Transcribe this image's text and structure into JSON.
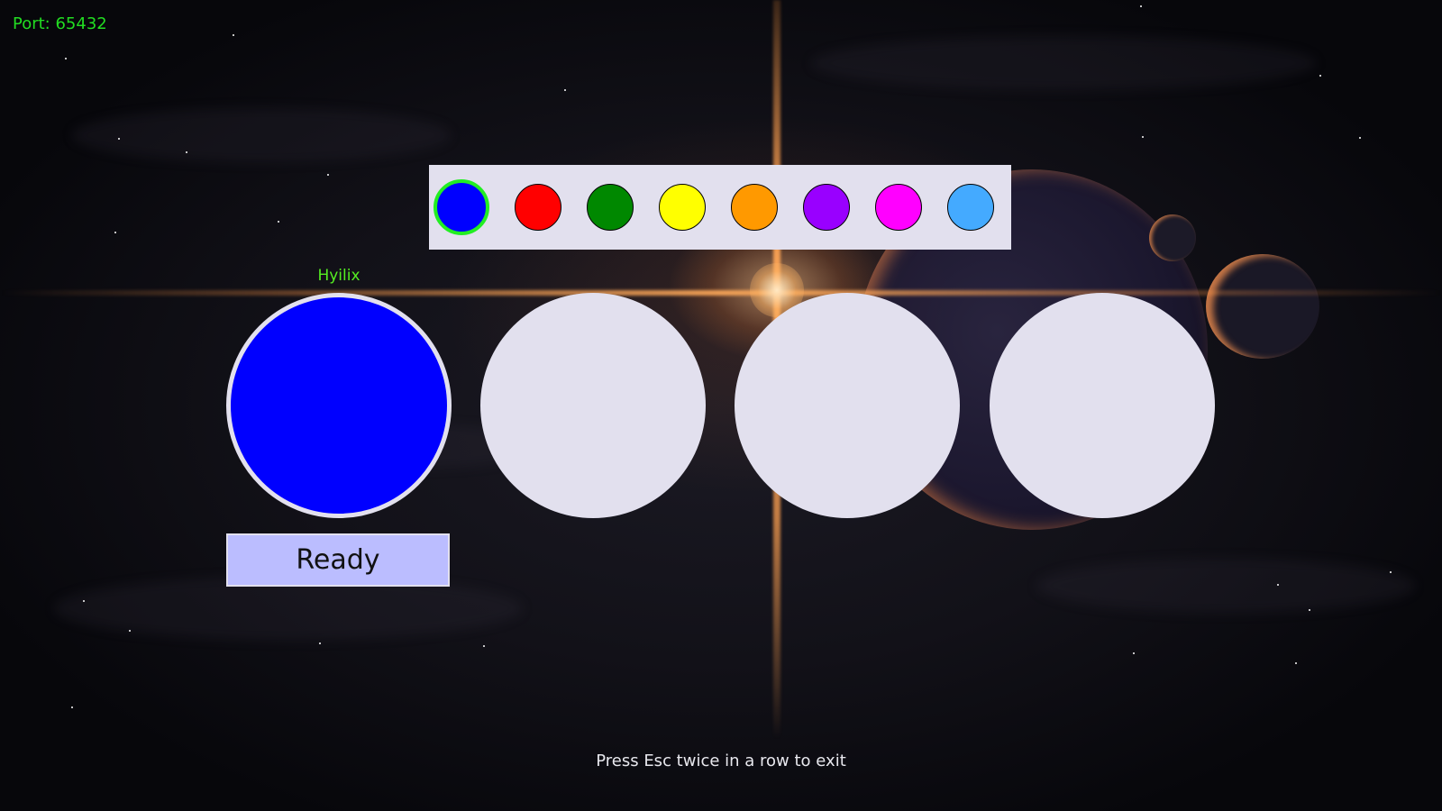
{
  "connection": {
    "port_text": "Port: 65432"
  },
  "palette": {
    "selected_index": 0,
    "colors": [
      {
        "name": "blue",
        "hex": "#0000ff"
      },
      {
        "name": "red",
        "hex": "#ff0000"
      },
      {
        "name": "green",
        "hex": "#008800"
      },
      {
        "name": "yellow",
        "hex": "#ffff00"
      },
      {
        "name": "orange",
        "hex": "#ff9900"
      },
      {
        "name": "purple",
        "hex": "#9900ff"
      },
      {
        "name": "magenta",
        "hex": "#ff00ff"
      },
      {
        "name": "sky-blue",
        "hex": "#44aaff"
      }
    ],
    "selection_ring_color": "#22ee22",
    "background_color": "#e2e0ee"
  },
  "players": [
    {
      "name": "Hyilix",
      "color": "#0000ff",
      "occupied": true
    },
    {
      "name": "",
      "color": "#e2e0ee",
      "occupied": false
    },
    {
      "name": "",
      "color": "#e2e0ee",
      "occupied": false
    },
    {
      "name": "",
      "color": "#e2e0ee",
      "occupied": false
    }
  ],
  "ready_button": {
    "label": "Ready",
    "color": "#bbbdff"
  },
  "footer": {
    "hint": "Press Esc twice in a row to exit"
  }
}
